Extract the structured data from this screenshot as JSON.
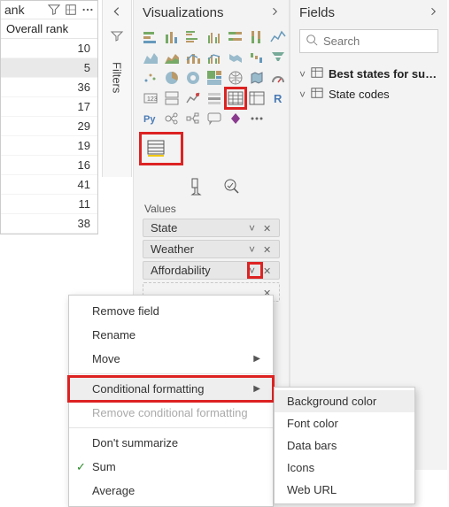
{
  "table": {
    "name_fragment": "ank",
    "column_header": "Overall rank",
    "rows": [
      10,
      5,
      36,
      17,
      29,
      19,
      16,
      41,
      11,
      38
    ],
    "selected_index": 1
  },
  "filters": {
    "label": "Filters"
  },
  "viz": {
    "title": "Visualizations",
    "section_values": "Values",
    "pills": [
      {
        "label": "State"
      },
      {
        "label": "Weather"
      },
      {
        "label": "Affordability"
      }
    ]
  },
  "fields": {
    "title": "Fields",
    "search_placeholder": "Search",
    "tables": [
      {
        "label": "Best states for sun...",
        "bold": true
      },
      {
        "label": "State codes",
        "bold": false
      }
    ]
  },
  "context_menu": {
    "items": [
      {
        "label": "Remove field"
      },
      {
        "label": "Rename"
      },
      {
        "label": "Move",
        "submenu": true
      },
      {
        "label": "Conditional formatting",
        "submenu": true,
        "highlight": true
      },
      {
        "label": "Remove conditional formatting",
        "disabled": true
      },
      {
        "label": "Don't summarize"
      },
      {
        "label": "Sum",
        "checked": true
      },
      {
        "label": "Average"
      }
    ]
  },
  "sub_menu": {
    "items": [
      {
        "label": "Background color",
        "hover": true
      },
      {
        "label": "Font color"
      },
      {
        "label": "Data bars"
      },
      {
        "label": "Icons"
      },
      {
        "label": "Web URL"
      }
    ]
  }
}
